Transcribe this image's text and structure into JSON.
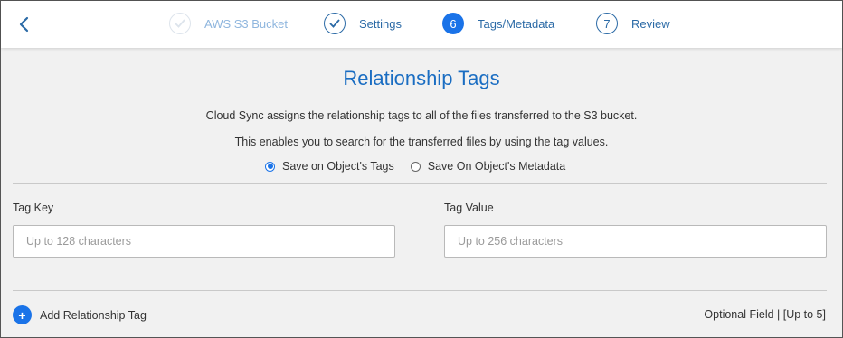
{
  "wizard": {
    "steps": [
      {
        "label": "AWS S3 Bucket",
        "number": "",
        "state": "completed-faded"
      },
      {
        "label": "Settings",
        "number": "",
        "state": "completed"
      },
      {
        "label": "Tags/Metadata",
        "number": "6",
        "state": "active"
      },
      {
        "label": "Review",
        "number": "7",
        "state": "upcoming"
      }
    ]
  },
  "main": {
    "title": "Relationship Tags",
    "description_1": "Cloud Sync assigns the relationship tags to all of the files transferred to the S3 bucket.",
    "description_2": "This enables you to search for the transferred files by using the tag values.",
    "storage_options": [
      {
        "label": "Save on Object's Tags",
        "selected": true
      },
      {
        "label": "Save On Object's Metadata",
        "selected": false
      }
    ],
    "tag_key": {
      "label": "Tag Key",
      "placeholder": "Up to 128 characters",
      "value": ""
    },
    "tag_value": {
      "label": "Tag Value",
      "placeholder": "Up to 256 characters",
      "value": ""
    },
    "add_label": "Add Relationship Tag",
    "optional_note": "Optional Field | [Up to 5]"
  },
  "colors": {
    "accent": "#1a73e8",
    "title": "#1a6dc2",
    "step_text": "#2b6aa6",
    "background": "#f1f1f1"
  },
  "icons": {
    "back": "chevron-left-icon",
    "completed": "check-icon",
    "add": "plus-icon"
  }
}
